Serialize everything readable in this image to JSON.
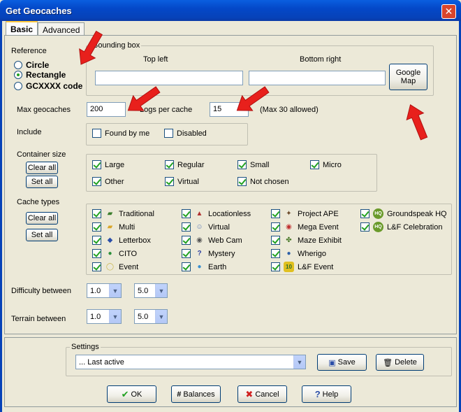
{
  "window": {
    "title": "Get Geocaches"
  },
  "tabs": [
    {
      "label": "Basic"
    },
    {
      "label": "Advanced"
    }
  ],
  "reference": {
    "label": "Reference",
    "options": [
      {
        "label": "Circle"
      },
      {
        "label": "Rectangle"
      },
      {
        "label": "GCXXXX code"
      }
    ],
    "selected": "Rectangle"
  },
  "bounding_box": {
    "legend": "Bounding box",
    "top_left_label": "Top left",
    "top_left_value": "",
    "bottom_right_label": "Bottom right",
    "bottom_right_value": "",
    "google_map_line1": "Google",
    "google_map_line2": "Map"
  },
  "limits": {
    "max_label": "Max geocaches",
    "max_value": "200",
    "logs_label": "Logs per cache",
    "logs_value": "15",
    "logs_note": "(Max 30 allowed)"
  },
  "include": {
    "label": "Include",
    "items": [
      {
        "label": "Found by me",
        "checked": false
      },
      {
        "label": "Disabled",
        "checked": false
      }
    ]
  },
  "container_size": {
    "label": "Container size",
    "clear_all": "Clear all",
    "set_all": "Set all",
    "items": [
      {
        "label": "Large",
        "checked": true
      },
      {
        "label": "Regular",
        "checked": true
      },
      {
        "label": "Small",
        "checked": true
      },
      {
        "label": "Micro",
        "checked": true
      },
      {
        "label": "Other",
        "checked": true
      },
      {
        "label": "Virtual",
        "checked": true
      },
      {
        "label": "Not chosen",
        "checked": true
      }
    ]
  },
  "cache_types": {
    "label": "Cache types",
    "clear_all": "Clear all",
    "set_all": "Set all",
    "items": [
      {
        "label": "Traditional",
        "icon": "traditional-icon",
        "color": "#3a7d2c"
      },
      {
        "label": "Multi",
        "icon": "multi-icon",
        "color": "#d9a62a"
      },
      {
        "label": "Letterbox",
        "icon": "letterbox-icon",
        "color": "#2b4ea8"
      },
      {
        "label": "CITO",
        "icon": "cito-icon",
        "color": "#2a8f3a"
      },
      {
        "label": "Event",
        "icon": "event-icon",
        "color": "#c9b44a"
      },
      {
        "label": "Locationless",
        "icon": "locationless-icon",
        "color": "#b03030"
      },
      {
        "label": "Virtual",
        "icon": "virtual-icon",
        "color": "#5a7ab8"
      },
      {
        "label": "Web Cam",
        "icon": "webcam-icon",
        "color": "#555555"
      },
      {
        "label": "Mystery",
        "icon": "mystery-icon",
        "color": "#2b3fa0"
      },
      {
        "label": "Earth",
        "icon": "earth-icon",
        "color": "#3a8fd0"
      },
      {
        "label": "Project APE",
        "icon": "project-ape-icon",
        "color": "#6b4a2a"
      },
      {
        "label": "Mega Event",
        "icon": "mega-event-icon",
        "color": "#c03030"
      },
      {
        "label": "Maze Exhibit",
        "icon": "maze-exhibit-icon",
        "color": "#4a7a2a"
      },
      {
        "label": "Wherigo",
        "icon": "wherigo-icon",
        "color": "#2b5fa8"
      },
      {
        "label": "L&F Event",
        "icon": "lf-event-icon",
        "color": "#e0c020"
      },
      {
        "label": "Groundspeak HQ",
        "icon": "groundspeak-hq-icon",
        "color": "#6a9a2a"
      },
      {
        "label": "L&F Celebration",
        "icon": "lf-celebration-icon",
        "color": "#6a9a2a"
      }
    ]
  },
  "difficulty": {
    "label": "Difficulty between",
    "min": "1.0",
    "max": "5.0"
  },
  "terrain": {
    "label": "Terrain between",
    "min": "1.0",
    "max": "5.0"
  },
  "settings": {
    "legend": "Settings",
    "selected": "... Last active",
    "save_label": "Save",
    "delete_label": "Delete"
  },
  "footer": {
    "ok": "OK",
    "balances": "Balances",
    "cancel": "Cancel",
    "help": "Help"
  },
  "colors": {
    "titlebar": "#0642b8",
    "arrow": "#e8201c",
    "check": "#21a121",
    "face": "#ece9d8"
  }
}
